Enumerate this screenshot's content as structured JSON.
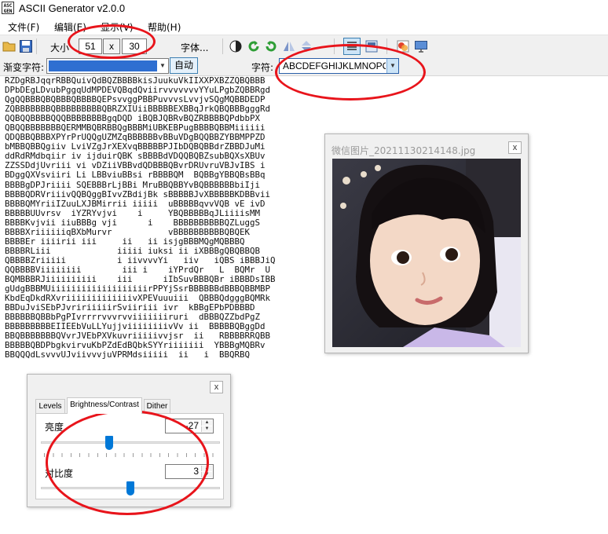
{
  "window": {
    "title": "ASCII Generator v2.0.0",
    "app_icon_text": "ASC II GEN"
  },
  "menu": [
    "文件(F)",
    "编辑(E)",
    "显示(V)",
    "帮助(H)"
  ],
  "toolbar": {
    "size_label": "大小",
    "width_value": "51",
    "times_label": "x",
    "height_value": "30",
    "font_label": "字体..."
  },
  "row2": {
    "gradient_label": "渐变字符:",
    "auto_label": "自动",
    "chars_label": "字符:",
    "chars_value": "ABCDEFGHIJKLMNOPQ"
  },
  "ascii_lines": [
    "RZDgRBJqqrRBBQuivQdBQZBBBBkisJuukuVkIIXXPXBZZQBQBBB",
    "DPbDEgLDvubPggqUdMPDEVQBqdQviirvvvvvvvYYuLPgbZQBBRgd",
    "QgQQBBBQBQBBBQBBBBQEPsvvggPBBPuvvvsLvvjvSQgMQBBDEDP",
    "ZQBBBBBBBQBBBBBBBBBQBRZXIUiiBBBBBEXBBqJrkQBQBBBgggRd",
    "QQBQQBBBBQQQBBBBBBBBgqDQD iBQBJQBRvBQZRBBBBQPdbbPX",
    "QBQQBBBBBBBQERMMBQBRBBQgBBBMiUBKEBPugBBBBQBBMiiiiii",
    "QDQBBQBBBXPYrPrUQQgUZMZqBBBBBBvBBuVDgBQQBBZYBBMPPZD",
    "bMBBQBBQgiiv LviVZgJrXEXvqBBBBBPJIbDQBQBBdrZBBDJuMi",
    "ddRdRMdbqiir iv ijduirQBK sBBBBdVDQQBQBZsubBQXsXBUv",
    "ZZSSDdjUvriii vi vDZiiVBBvdQDBBBQBvrDRUvruVBJvIBS i",
    "BDggQXVsviiri Li LBBviuBBsi rBBBBQM  BQBBgYBBQBsBBq",
    "BBBBgDPJriiii SQEBBBrLjBBi MruBBQBBYvBQBBBBBBbiIji",
    "BBBBQDRVriiivQQBQggBIvvZBdijBk sBBBBBJvXBBBBBKDBBvii",
    "BBBBQMYriiIZuuLXJBMirrii iiiii  uBBBBBqvvVQB vE ivD",
    "BBBBBUUvrsv  iYZRYvjvi    i     YBQBBBBBqJLiiiisMM",
    "BBBBKvjvii iiuBBBg vji      i    BBBBBBBBBBQZLuggS",
    "BBBBXriiiiiiqBXbMurvr           vBBBBBBBBBBQBQEK",
    "BBBBEr iiiirii iii     ii   ii isjgBBBMQgMQBBBQ",
    "BBBBRLiii             iiiii iuksi ii iXBBBgQBQBBQB",
    "QBBBBZriiiii          i iivvvvYi   iiv   iQBS iBBBJiQ",
    "QQBBBBViiiiiiii        iii i    iYPrdQr   L  BQMr  U",
    "BQMBBBRJiiiiiiiiii    iii      iIbSuvBBBQBr iBBBDsIBB",
    "gUdgBBBMUiiiiiiiiiiiiiiiiiiirPPYjSsrBBBBBBdBBBQBBMBP",
    "KbdEqDkdRXvriiiiiiiiiiiiivXPEVuuuiii  QBBBQdgggBQMRk",
    "BBDuJviSEbPJvririiiiirSviiriii ivr  kBBgEPbPDBBBD",
    "BBBBBBQBBbPgPIvrrrrvvvrvviiiiiiiruri  dBBBQZZbdPgZ",
    "BBBBBBBBBEIIEEbVuLLYujjviiiiiiiivVv ii  BBBBBQBggDd",
    "BBQBBBBBBBQVvrJVEbPXVkuvriiiiivvjsr  ii   RBBBBRRQBB",
    "BBBBBQBDPbgkvirvuKbPZdEdBQbkSYYriiiiiii  YBBBgMQBRv",
    "BBQQQdLsvvvUJviivvvjuVPRMdsiiiii  ii   i  BBQRBQ"
  ],
  "image_window": {
    "title": "微信图片_20211130214148.jpg",
    "close_label": "x"
  },
  "dialog": {
    "close_label": "x",
    "tabs": [
      "Levels",
      "Brightness/Contrast",
      "Dither"
    ],
    "brightness_label": "亮度",
    "brightness_value": "-27",
    "brightness_fraction": 0.38,
    "contrast_label": "对比度",
    "contrast_value": "3",
    "contrast_fraction": 0.5
  }
}
